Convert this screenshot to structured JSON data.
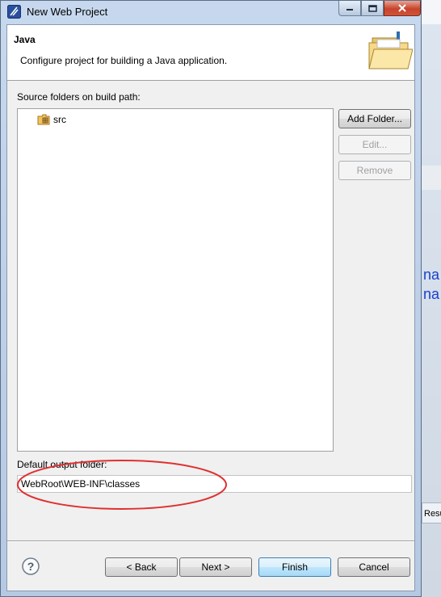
{
  "window": {
    "title": "New Web Project"
  },
  "banner": {
    "title": "Java",
    "description": "Configure project for building a Java application.",
    "icon": "folder-wizard-icon"
  },
  "source_folders": {
    "label": "Source folders on build path:",
    "items": [
      {
        "label": "src",
        "icon": "package-folder-icon"
      }
    ],
    "buttons": {
      "add_folder": "Add Folder...",
      "edit": "Edit...",
      "remove": "Remove"
    }
  },
  "output": {
    "label": "Default output folder:",
    "value": "WebRoot\\WEB-INF\\classes",
    "annotation_color": "#e03030"
  },
  "footer": {
    "back": "< Back",
    "next": "Next >",
    "finish": "Finish",
    "cancel": "Cancel"
  },
  "background": {
    "fragment_1": "na",
    "fragment_2": "na",
    "tab_fragment": "Resu"
  }
}
